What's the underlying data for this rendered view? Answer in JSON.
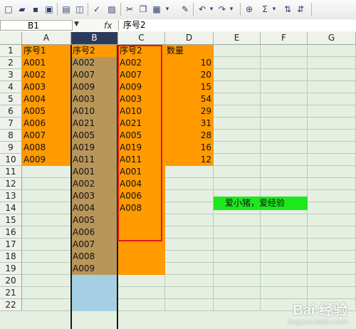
{
  "toolbar": {
    "buttons": [
      "new-icon",
      "open-icon",
      "save-icon",
      "permission-icon",
      "print-icon",
      "preview-icon",
      "spelling-icon",
      "research-icon",
      "cut-icon",
      "copy-icon",
      "paste-icon",
      "paste-dropdown-icon",
      "format-painter-icon",
      "undo-icon",
      "undo-dropdown-icon",
      "redo-icon",
      "redo-dropdown-icon",
      "hyperlink-icon",
      "autosum-icon",
      "autosum-dropdown-icon",
      "sort-ascending-icon",
      "sort-descending-icon"
    ],
    "glyphs": [
      "□",
      "▰",
      "▪",
      "▣",
      "▤",
      "◫",
      "✓",
      "▨",
      "✂",
      "❐",
      "▦",
      "▾",
      "✎",
      "↶",
      "▾",
      "↷",
      "▾",
      "⊛",
      "Σ",
      "▾",
      "⇅",
      "⇵"
    ]
  },
  "formula_bar": {
    "name_box": "B1",
    "fx": "fx",
    "content": "序号2"
  },
  "columns": [
    "A",
    "B",
    "C",
    "D",
    "E",
    "F",
    "G"
  ],
  "selected_column": "B",
  "rows": [
    "1",
    "2",
    "3",
    "4",
    "5",
    "6",
    "7",
    "8",
    "9",
    "10",
    "11",
    "12",
    "13",
    "14",
    "15",
    "16",
    "17",
    "18",
    "19",
    "20",
    "21",
    "22"
  ],
  "sheet": {
    "col_a": [
      "序号1",
      "A001",
      "A002",
      "A003",
      "A004",
      "A005",
      "A006",
      "A007",
      "A008",
      "A009"
    ],
    "col_b": [
      "序号2",
      "A002",
      "A007",
      "A009",
      "A003",
      "A010",
      "A021",
      "A005",
      "A019",
      "A011",
      "A001",
      "A002",
      "A003",
      "A004",
      "A005",
      "A006",
      "A007",
      "A008",
      "A009"
    ],
    "col_c": [
      "序号2",
      "A002",
      "A007",
      "A009",
      "A003",
      "A010",
      "A021",
      "A005",
      "A019",
      "A011",
      "A001",
      "A004",
      "A006",
      "A008"
    ],
    "col_d_header": "数量",
    "col_d_values": [
      "10",
      "20",
      "15",
      "54",
      "29",
      "31",
      "28",
      "16",
      "12"
    ]
  },
  "note": "爱小猪，爱经验",
  "watermark": {
    "brand": "Bai 经验",
    "url": "jingyan.baidu.com"
  },
  "colors": {
    "orange": "#ff9a00",
    "tan": "#b8965a",
    "light_blue": "#a6cfe4",
    "green": "#1ee81e",
    "red_outline": "#e01818"
  }
}
